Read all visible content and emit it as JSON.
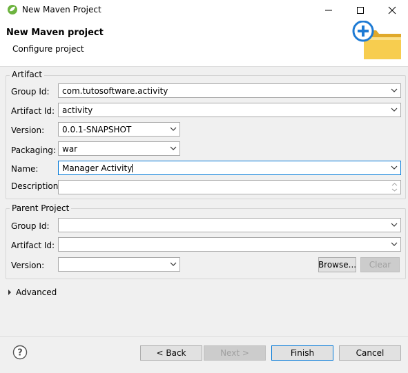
{
  "window": {
    "title": "New Maven Project"
  },
  "header": {
    "title": "New Maven project",
    "subtitle": "Configure project"
  },
  "artifact": {
    "legend": "Artifact",
    "group_id": {
      "label": "Group Id:",
      "value": "com.tutosoftware.activity"
    },
    "artifact_id": {
      "label": "Artifact Id:",
      "value": "activity"
    },
    "version": {
      "label": "Version:",
      "value": "0.0.1-SNAPSHOT"
    },
    "packaging": {
      "label": "Packaging:",
      "value": "war"
    },
    "name": {
      "label": "Name:",
      "value": "Manager Activity"
    },
    "description": {
      "label": "Description:",
      "value": ""
    }
  },
  "parent": {
    "legend": "Parent Project",
    "group_id": {
      "label": "Group Id:",
      "value": ""
    },
    "artifact_id": {
      "label": "Artifact Id:",
      "value": ""
    },
    "version": {
      "label": "Version:",
      "value": ""
    },
    "browse_label": "Browse...",
    "clear_label": "Clear"
  },
  "advanced": {
    "label": "Advanced"
  },
  "footer": {
    "back_label": "< Back",
    "next_label": "Next >",
    "finish_label": "Finish",
    "cancel_label": "Cancel"
  },
  "icons": {
    "app": "maven-leaf-icon",
    "minimize": "minimize-icon",
    "maximize": "maximize-icon",
    "close": "close-icon",
    "banner": "new-folder-plus-icon",
    "help": "help-icon"
  },
  "colors": {
    "accent": "#0078d7",
    "folder": "#f5c542",
    "plus": "#1e7bd4"
  }
}
